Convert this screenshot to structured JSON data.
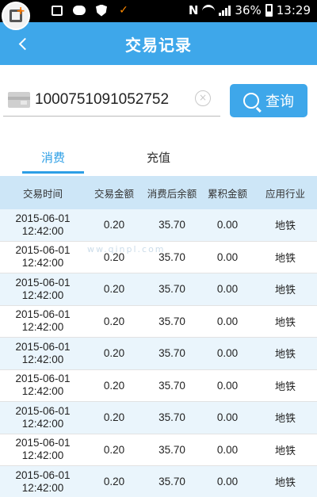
{
  "status_bar": {
    "network": "N",
    "battery": "36%",
    "time": "13:29"
  },
  "header": {
    "title": "交易记录"
  },
  "search": {
    "card_number": "1000751091052752",
    "query_label": "查询",
    "clear_symbol": "×"
  },
  "tabs": [
    {
      "label": "消费",
      "active": true
    },
    {
      "label": "充值",
      "active": false
    }
  ],
  "table": {
    "columns": [
      "交易时间",
      "交易金额",
      "消费后余额",
      "累积金额",
      "应用行业"
    ],
    "rows": [
      {
        "date": "2015-06-01",
        "time": "12:42:00",
        "amount": "0.20",
        "balance": "35.70",
        "accumulated": "0.00",
        "industry": "地铁"
      },
      {
        "date": "2015-06-01",
        "time": "12:42:00",
        "amount": "0.20",
        "balance": "35.70",
        "accumulated": "0.00",
        "industry": "地铁"
      },
      {
        "date": "2015-06-01",
        "time": "12:42:00",
        "amount": "0.20",
        "balance": "35.70",
        "accumulated": "0.00",
        "industry": "地铁"
      },
      {
        "date": "2015-06-01",
        "time": "12:42:00",
        "amount": "0.20",
        "balance": "35.70",
        "accumulated": "0.00",
        "industry": "地铁"
      },
      {
        "date": "2015-06-01",
        "time": "12:42:00",
        "amount": "0.20",
        "balance": "35.70",
        "accumulated": "0.00",
        "industry": "地铁"
      },
      {
        "date": "2015-06-01",
        "time": "12:42:00",
        "amount": "0.20",
        "balance": "35.70",
        "accumulated": "0.00",
        "industry": "地铁"
      },
      {
        "date": "2015-06-01",
        "time": "12:42:00",
        "amount": "0.20",
        "balance": "35.70",
        "accumulated": "0.00",
        "industry": "地铁"
      },
      {
        "date": "2015-06-01",
        "time": "12:42:00",
        "amount": "0.20",
        "balance": "35.70",
        "accumulated": "0.00",
        "industry": "地铁"
      },
      {
        "date": "2015-06-01",
        "time": "12:42:00",
        "amount": "0.20",
        "balance": "35.70",
        "accumulated": "0.00",
        "industry": "地铁"
      }
    ]
  },
  "watermark": "ww.qinpl.com",
  "colors": {
    "primary": "#3ea7ea",
    "tab_active": "#2d9fe6",
    "header_bg": "#cde6f7",
    "row_alt_bg": "#eaf5fc"
  },
  "icons": {
    "app": "add-square-icon",
    "back": "chevron-left-icon",
    "card": "card-icon",
    "clear": "clear-circle-icon",
    "search": "search-icon"
  }
}
